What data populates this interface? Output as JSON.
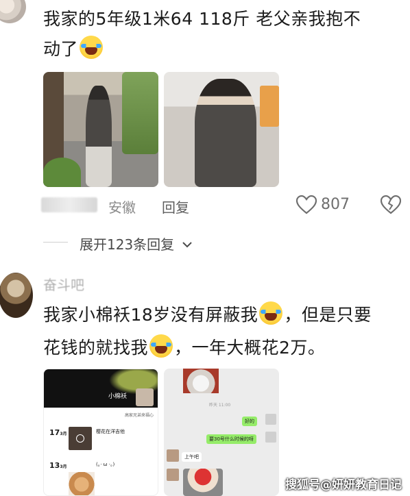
{
  "comment1": {
    "text_line1": "我家的5年级1米64 118斤 老父亲我抱不",
    "text_line2": "动了",
    "location": "安徽",
    "reply_label": "回复",
    "like_count": "807",
    "expand_label": "展开123条回复"
  },
  "comment2": {
    "username": "奋斗吧",
    "text_line1a": "我家小棉袄18岁没有屏蔽我",
    "text_line1b": "，但是只要",
    "text_line2a": "花钱的就找我",
    "text_line2b": "，一年大概花2万。"
  },
  "screenshot_left": {
    "name": "小棉袄",
    "caption": "高家兄弟来福心",
    "entry1_date": "17",
    "entry1_month": "3月",
    "entry1_text": "樱花在洋吉他",
    "entry2_date": "13",
    "entry2_month": "3月",
    "entry2_text": "(。· ω ·。)"
  },
  "screenshot_right": {
    "time": "昨天 11:00",
    "msg1": "好的",
    "msg2": "要30号什么时候的呀",
    "msg3": "上午吧"
  },
  "watermark": "搜狐号@妍妍教育日记",
  "colors": {
    "like_gray": "#6f6f6f",
    "meta_gray": "#8a8a8a",
    "wechat_green": "#95ec69"
  }
}
